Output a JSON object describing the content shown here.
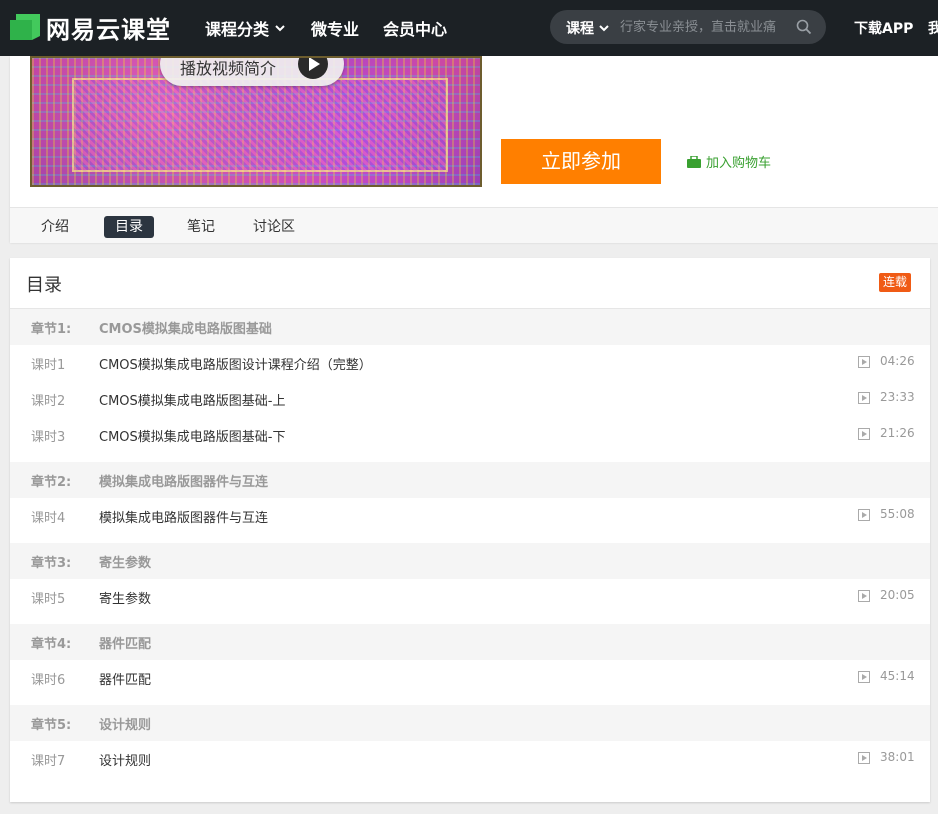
{
  "topnav": {
    "logo_text": "网易云课堂",
    "items": [
      "课程分类",
      "微专业",
      "会员中心"
    ],
    "search": {
      "category": "课程",
      "placeholder": "行家专业亲授，直击就业痛"
    },
    "download": "下载APP",
    "overflow_text": "我"
  },
  "course": {
    "play_label": "播放视频简介",
    "join_label": "立即参加",
    "cart_label": "加入购物车",
    "tabs": [
      "介绍",
      "目录",
      "笔记",
      "讨论区"
    ],
    "active_tab": "目录"
  },
  "catalog": {
    "title": "目录",
    "badge": "连载",
    "chapters": [
      {
        "no": "章节1:",
        "title": "CMOS模拟集成电路版图基础",
        "lessons": [
          {
            "no": "课时1",
            "title": "CMOS模拟集成电路版图设计课程介绍（完整）",
            "duration": "04:26"
          },
          {
            "no": "课时2",
            "title": "CMOS模拟集成电路版图基础-上",
            "duration": "23:33"
          },
          {
            "no": "课时3",
            "title": "CMOS模拟集成电路版图基础-下",
            "duration": "21:26"
          }
        ]
      },
      {
        "no": "章节2:",
        "title": "模拟集成电路版图器件与互连",
        "lessons": [
          {
            "no": "课时4",
            "title": "模拟集成电路版图器件与互连",
            "duration": "55:08"
          }
        ]
      },
      {
        "no": "章节3:",
        "title": "寄生参数",
        "lessons": [
          {
            "no": "课时5",
            "title": "寄生参数",
            "duration": "20:05"
          }
        ]
      },
      {
        "no": "章节4:",
        "title": "器件匹配",
        "lessons": [
          {
            "no": "课时6",
            "title": "器件匹配",
            "duration": "45:14"
          }
        ]
      },
      {
        "no": "章节5:",
        "title": "设计规则",
        "lessons": [
          {
            "no": "课时7",
            "title": "设计规则",
            "duration": "38:01"
          }
        ]
      }
    ]
  },
  "colors": {
    "nav_bg": "#1c2125",
    "join_button": "#ff7f00",
    "cart_green": "#39a030",
    "badge_orange": "#f05b15",
    "logo_green": "#2fb24a"
  },
  "icons": [
    "logo-icon",
    "chevron-down-icon",
    "search-icon",
    "play-icon",
    "cart-icon",
    "video-icon"
  ]
}
